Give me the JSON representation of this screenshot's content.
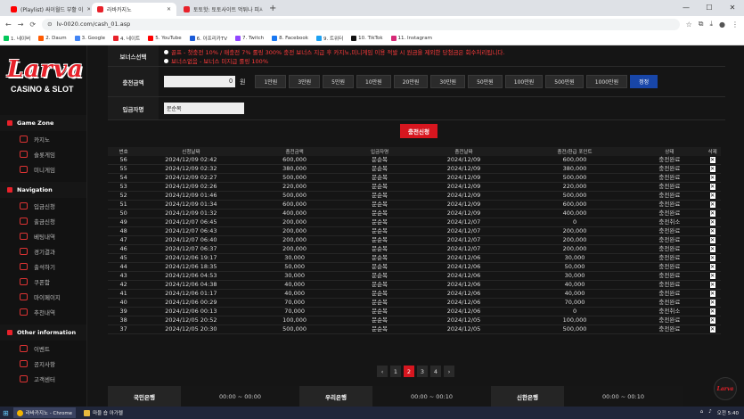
{
  "browser": {
    "tabs": [
      {
        "label": "(Playlist) 싸이월드 부활 이",
        "active": false,
        "color": "#ff0000"
      },
      {
        "label": "라바카지노",
        "active": true,
        "color": "#e8212a"
      },
      {
        "label": "토토핫: 토토사이트 먹튀나 피시",
        "active": false,
        "color": "#e8212a"
      }
    ],
    "url": "lv-0020.com/cash_01.asp",
    "bookmarks": [
      {
        "label": "1. 네이버",
        "color": "#03c75a"
      },
      {
        "label": "2. Daum",
        "color": "#ff5a00"
      },
      {
        "label": "3. Google",
        "color": "#4285f4"
      },
      {
        "label": "4. 네이트",
        "color": "#e8212a"
      },
      {
        "label": "5. YouTube",
        "color": "#ff0000"
      },
      {
        "label": "6. 아프리카TV",
        "color": "#1a5bd8"
      },
      {
        "label": "7. Twitch",
        "color": "#9146ff"
      },
      {
        "label": "8. Facebook",
        "color": "#1877f2"
      },
      {
        "label": "9. 트위터",
        "color": "#1da1f2"
      },
      {
        "label": "10. TikTok",
        "color": "#111111"
      },
      {
        "label": "11. Instagram",
        "color": "#d62976"
      }
    ]
  },
  "sidebar": {
    "logo": "Larva",
    "logo_sub": "CASINO & SLOT",
    "sections": [
      {
        "title": "Game Zone",
        "items": [
          "카지노",
          "슬롯게임",
          "미니게임"
        ]
      },
      {
        "title": "Navigation",
        "items": [
          "입금신청",
          "출금신청",
          "베팅내역",
          "경기결과",
          "출석하기",
          "쿠폰함",
          "마이페이지",
          "추천내역"
        ]
      },
      {
        "title": "Other information",
        "items": [
          "이벤트",
          "공지사항",
          "고객센터"
        ]
      }
    ]
  },
  "form": {
    "bonus_label": "보너스선택",
    "bonus_line1": "골프 - 첫충전 10% / 매충전 7% 롤링 300% 충전 보너스 지급 후 카지노,미니게임 이용 적발 시 원금을 제외한 당첨금은 회수처리됩니다.",
    "bonus_line2": "보너스없음 - 보너스 미지급 롤링 100%",
    "amount_label": "충전금액",
    "amount_value": "0",
    "won": "원",
    "amount_buttons": [
      "1만원",
      "3만원",
      "5만원",
      "10만원",
      "20만원",
      "30만원",
      "50만원",
      "100만원",
      "500만원",
      "1000만원"
    ],
    "reset_label": "정정",
    "name_label": "입금자명",
    "name_value": "문순복",
    "submit_label": "충전신청"
  },
  "table": {
    "headers": [
      "번호",
      "신청날짜",
      "충전금액",
      "입금자명",
      "충전날짜",
      "충전/환급 포인트",
      "상태",
      "삭제"
    ],
    "rows": [
      [
        "56",
        "2024/12/09 02:42",
        "600,000",
        "문순복",
        "2024/12/09",
        "600,000",
        "충전완료"
      ],
      [
        "55",
        "2024/12/09 02:32",
        "380,000",
        "문순복",
        "2024/12/09",
        "380,000",
        "충전완료"
      ],
      [
        "54",
        "2024/12/09 02:27",
        "500,000",
        "문순복",
        "2024/12/09",
        "500,000",
        "충전완료"
      ],
      [
        "53",
        "2024/12/09 02:26",
        "220,000",
        "문순복",
        "2024/12/09",
        "220,000",
        "충전완료"
      ],
      [
        "52",
        "2024/12/09 01:46",
        "500,000",
        "문순복",
        "2024/12/09",
        "500,000",
        "충전완료"
      ],
      [
        "51",
        "2024/12/09 01:34",
        "600,000",
        "문순복",
        "2024/12/09",
        "600,000",
        "충전완료"
      ],
      [
        "50",
        "2024/12/09 01:32",
        "400,000",
        "문순복",
        "2024/12/09",
        "400,000",
        "충전완료"
      ],
      [
        "49",
        "2024/12/07 06:45",
        "200,000",
        "문순복",
        "2024/12/07",
        "0",
        "충전취소"
      ],
      [
        "48",
        "2024/12/07 06:43",
        "200,000",
        "문순복",
        "2024/12/07",
        "200,000",
        "충전완료"
      ],
      [
        "47",
        "2024/12/07 06:40",
        "200,000",
        "문순복",
        "2024/12/07",
        "200,000",
        "충전완료"
      ],
      [
        "46",
        "2024/12/07 06:37",
        "200,000",
        "문순복",
        "2024/12/07",
        "200,000",
        "충전완료"
      ],
      [
        "45",
        "2024/12/06 19:17",
        "30,000",
        "문순복",
        "2024/12/06",
        "30,000",
        "충전완료"
      ],
      [
        "44",
        "2024/12/06 18:35",
        "50,000",
        "문순복",
        "2024/12/06",
        "50,000",
        "충전완료"
      ],
      [
        "43",
        "2024/12/06 04:53",
        "30,000",
        "문순복",
        "2024/12/06",
        "30,000",
        "충전완료"
      ],
      [
        "42",
        "2024/12/06 04:38",
        "40,000",
        "문순복",
        "2024/12/06",
        "40,000",
        "충전완료"
      ],
      [
        "41",
        "2024/12/06 01:17",
        "40,000",
        "문순복",
        "2024/12/06",
        "40,000",
        "충전완료"
      ],
      [
        "40",
        "2024/12/06 00:29",
        "70,000",
        "문순복",
        "2024/12/06",
        "70,000",
        "충전완료"
      ],
      [
        "39",
        "2024/12/06 00:13",
        "70,000",
        "문순복",
        "2024/12/06",
        "0",
        "충전취소"
      ],
      [
        "38",
        "2024/12/05 20:52",
        "100,000",
        "문순복",
        "2024/12/05",
        "100,000",
        "충전완료"
      ],
      [
        "37",
        "2024/12/05 20:30",
        "500,000",
        "문순복",
        "2024/12/05",
        "500,000",
        "충전완료"
      ]
    ]
  },
  "pager": {
    "prev": "‹",
    "next": "›",
    "pages": [
      "1",
      "2",
      "3",
      "4"
    ],
    "current": "2"
  },
  "banks": [
    {
      "name": "국민은행",
      "hours": "00:00 ~ 00:00"
    },
    {
      "name": "우리은행",
      "hours": "00:00 ~ 00:10"
    },
    {
      "name": "신한은행",
      "hours": "00:00 ~ 00:10"
    }
  ],
  "taskbar": {
    "items": [
      "라바카지노 - Chrome",
      "마을 숍 아가렐"
    ],
    "time": "오전 5:40"
  }
}
